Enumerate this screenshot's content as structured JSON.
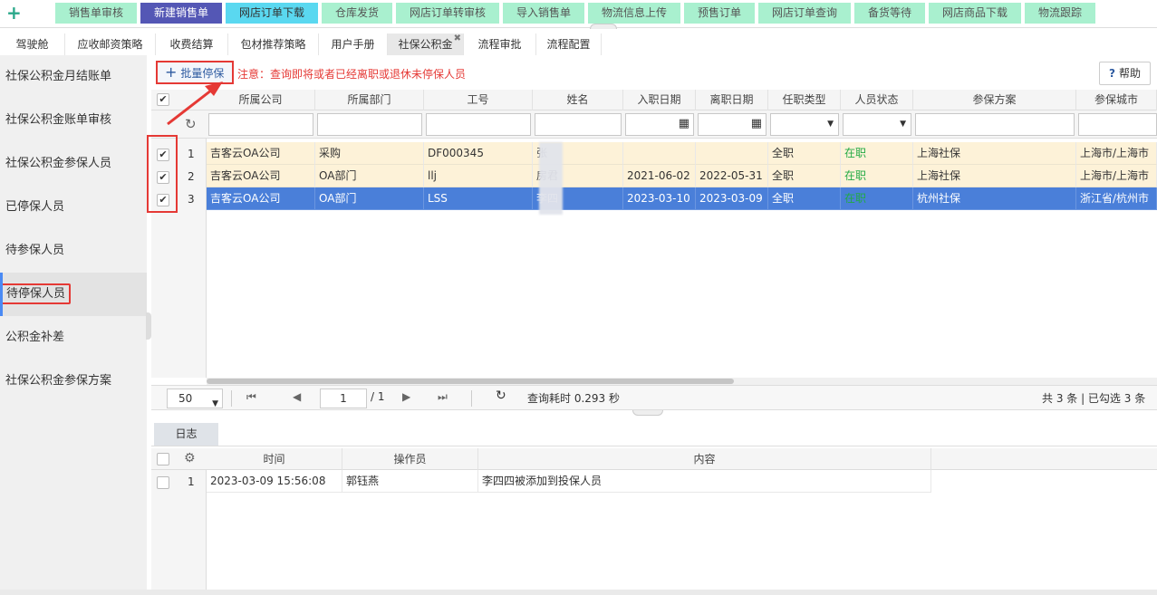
{
  "top_menu": {
    "items": [
      "销售单审核",
      "新建销售单",
      "网店订单下载",
      "仓库发货",
      "网店订单转审核",
      "导入销售单",
      "物流信息上传",
      "预售订单",
      "网店订单查询",
      "备货等待",
      "网店商品下载",
      "物流跟踪"
    ]
  },
  "tabs": [
    "驾驶舱",
    "应收邮资策略",
    "收费结算",
    "包材推荐策略",
    "用户手册",
    "社保公积金",
    "流程审批",
    "流程配置"
  ],
  "sidebar": {
    "items": [
      "社保公积金月结账单",
      "社保公积金账单审核",
      "社保公积金参保人员",
      "已停保人员",
      "待参保人员",
      "待停保人员",
      "公积金补差",
      "社保公积金参保方案"
    ]
  },
  "toolbar": {
    "batch_label": "批量停保",
    "notice": "注意：查询即将或者已经离职或退休未停保人员",
    "help_label": "帮助"
  },
  "grid": {
    "headers": [
      "所属公司",
      "所属部门",
      "工号",
      "姓名",
      "入职日期",
      "离职日期",
      "任职类型",
      "人员状态",
      "参保方案",
      "参保城市"
    ],
    "rows": [
      {
        "num": "1",
        "company": "吉客云OA公司",
        "dept": "采购",
        "code": "DF000345",
        "name": "张",
        "join": "",
        "leave": "",
        "type": "全职",
        "status": "在职",
        "plan": "上海社保",
        "city": "上海市/上海市"
      },
      {
        "num": "2",
        "company": "吉客云OA公司",
        "dept": "OA部门",
        "code": "llj",
        "name": "房君",
        "join": "2021-06-02",
        "leave": "2022-05-31",
        "type": "全职",
        "status": "在职",
        "plan": "上海社保",
        "city": "上海市/上海市"
      },
      {
        "num": "3",
        "company": "吉客云OA公司",
        "dept": "OA部门",
        "code": "LSS",
        "name": "李四",
        "join": "2023-03-10",
        "leave": "2023-03-09",
        "type": "全职",
        "status": "在职",
        "plan": "杭州社保",
        "city": "浙江省/杭州市"
      }
    ]
  },
  "pager": {
    "page_size": "50",
    "current_page": "1",
    "total_pages": "/ 1",
    "query_time": "查询耗时 0.293 秒",
    "summary": "共 3 条 | 已勾选 3 条"
  },
  "log": {
    "tab_label": "日志",
    "headers": [
      "时间",
      "操作员",
      "内容"
    ],
    "rows": [
      {
        "num": "1",
        "time": "2023-03-09 15:56:08",
        "operator": "郭钰燕",
        "content": "李四四被添加到投保人员"
      }
    ]
  },
  "colors": {
    "accent": "#4a7fd9",
    "warn": "#e53935",
    "menu": "#a9f0cf",
    "menu_active": "#5457b5"
  }
}
